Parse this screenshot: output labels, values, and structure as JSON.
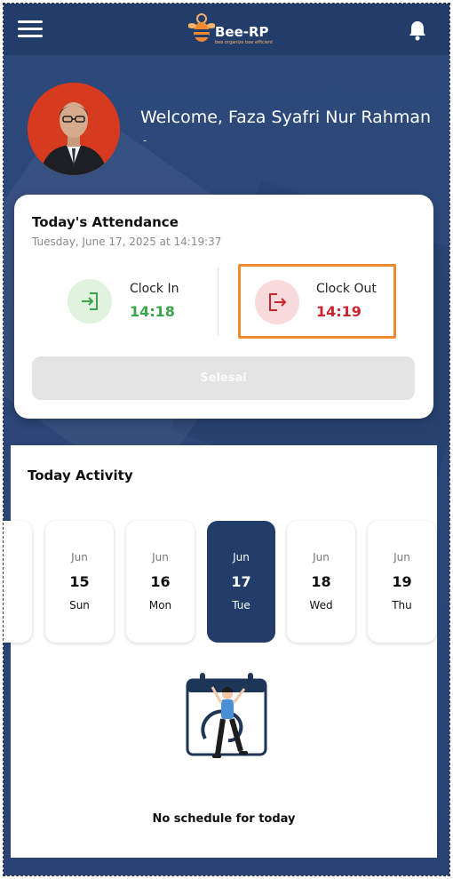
{
  "app": {
    "logo_text": "Bee-RP",
    "logo_tagline": "bee organize bee efficient"
  },
  "profile": {
    "welcome": "Welcome,  Faza Syafri Nur Rahman",
    "subtitle": "-"
  },
  "attendance": {
    "title": "Today's Attendance",
    "datetime": "Tuesday, June 17, 2025 at 14:19:37",
    "clock_in": {
      "label": "Clock In",
      "time": "14:18"
    },
    "clock_out": {
      "label": "Clock Out",
      "time": "14:19"
    },
    "button_label": "Selesai"
  },
  "activity": {
    "title": "Today Activity",
    "days": [
      {
        "month": "Jun",
        "day": "15",
        "weekday": "Sun"
      },
      {
        "month": "Jun",
        "day": "16",
        "weekday": "Mon"
      },
      {
        "month": "Jun",
        "day": "17",
        "weekday": "Tue",
        "selected": true
      },
      {
        "month": "Jun",
        "day": "18",
        "weekday": "Wed"
      },
      {
        "month": "Jun",
        "day": "19",
        "weekday": "Thu"
      }
    ],
    "empty_message": "No schedule for today"
  },
  "colors": {
    "primary": "#233d6b",
    "clock_in": "#3aa54a",
    "clock_out": "#c6262e",
    "highlight": "#f08a30"
  },
  "icons": [
    "menu-icon",
    "bell-icon",
    "clock-in-icon",
    "clock-out-icon",
    "calendar-illustration"
  ]
}
